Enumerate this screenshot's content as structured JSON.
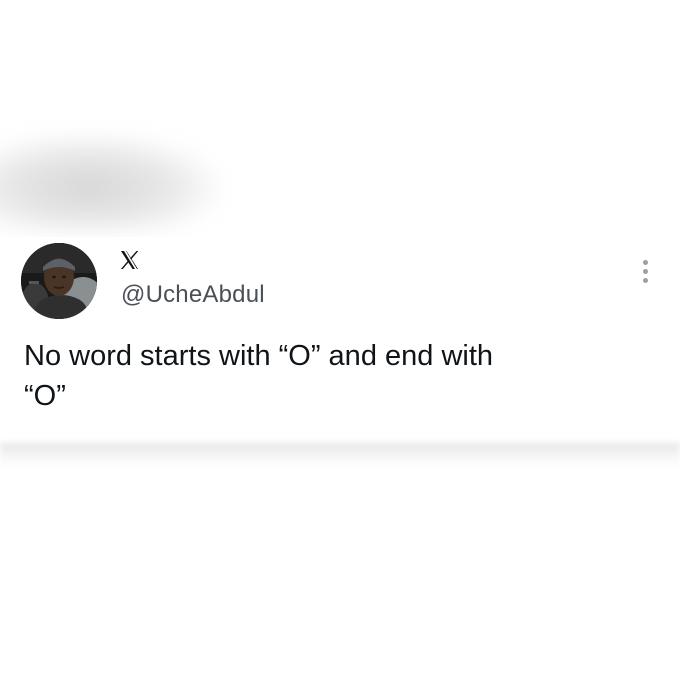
{
  "tweet": {
    "platform_icon": "x-logo-icon",
    "handle": "@UcheAbdul",
    "text": "No word starts with “O” and end with\n“O”",
    "avatar": "profile-photo-avatar",
    "menu_icon": "more-vertical-icon"
  },
  "colors": {
    "background": "#ffffff",
    "text": "#0f1419",
    "handle": "#4a5058",
    "menu_dots": "#9aa0a6"
  }
}
